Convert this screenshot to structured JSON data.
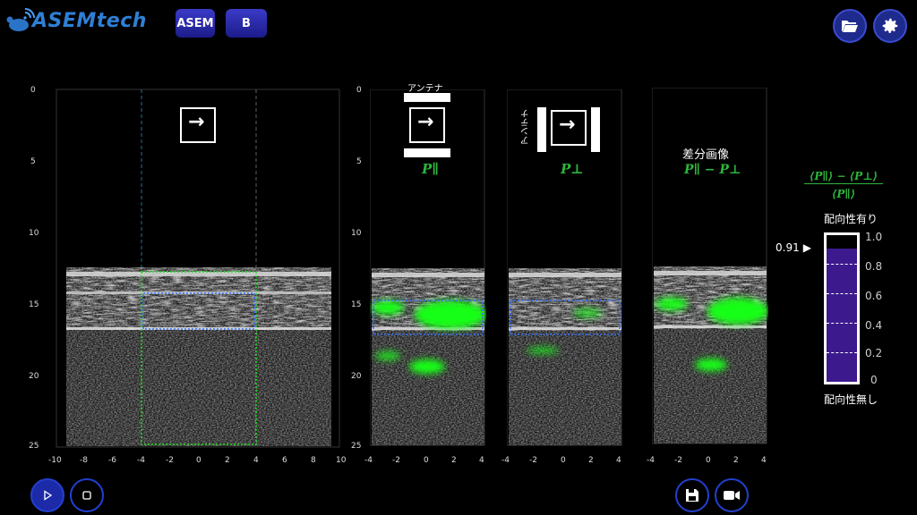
{
  "header": {
    "logo_text": "ASEMtech",
    "mode_buttons": [
      "ASEM",
      "B"
    ]
  },
  "panels": {
    "y_ticks": [
      "0",
      "5",
      "10",
      "15",
      "20",
      "25"
    ],
    "main_x_ticks": [
      "-10",
      "-8",
      "-6",
      "-4",
      "-2",
      "0",
      "2",
      "4",
      "6",
      "8",
      "10"
    ],
    "small_x_ticks": [
      "-4",
      "-2",
      "0",
      "2",
      "4"
    ],
    "antenna_label": "アンテナ",
    "p_parallel": "P∥",
    "p_perp": "P⊥",
    "diff_title": "差分画像",
    "diff_formula": "P∥ − P⊥",
    "arrow": "→"
  },
  "scale": {
    "formula_numerator": "⟨P∥⟩ − ⟨P⊥⟩",
    "formula_denominator": "⟨P∥⟩",
    "top_label": "配向性有り",
    "bottom_label": "配向性無し",
    "ticks": [
      "1.0",
      "0.8",
      "0.6",
      "0.4",
      "0.2",
      "0"
    ],
    "value": 0.91,
    "value_label": "0.91",
    "bar_color": "#3c1a8e"
  },
  "colors": {
    "accent": "#1f2b8c",
    "highlight_green": "#19ff19",
    "label_green": "#2eb63c"
  }
}
